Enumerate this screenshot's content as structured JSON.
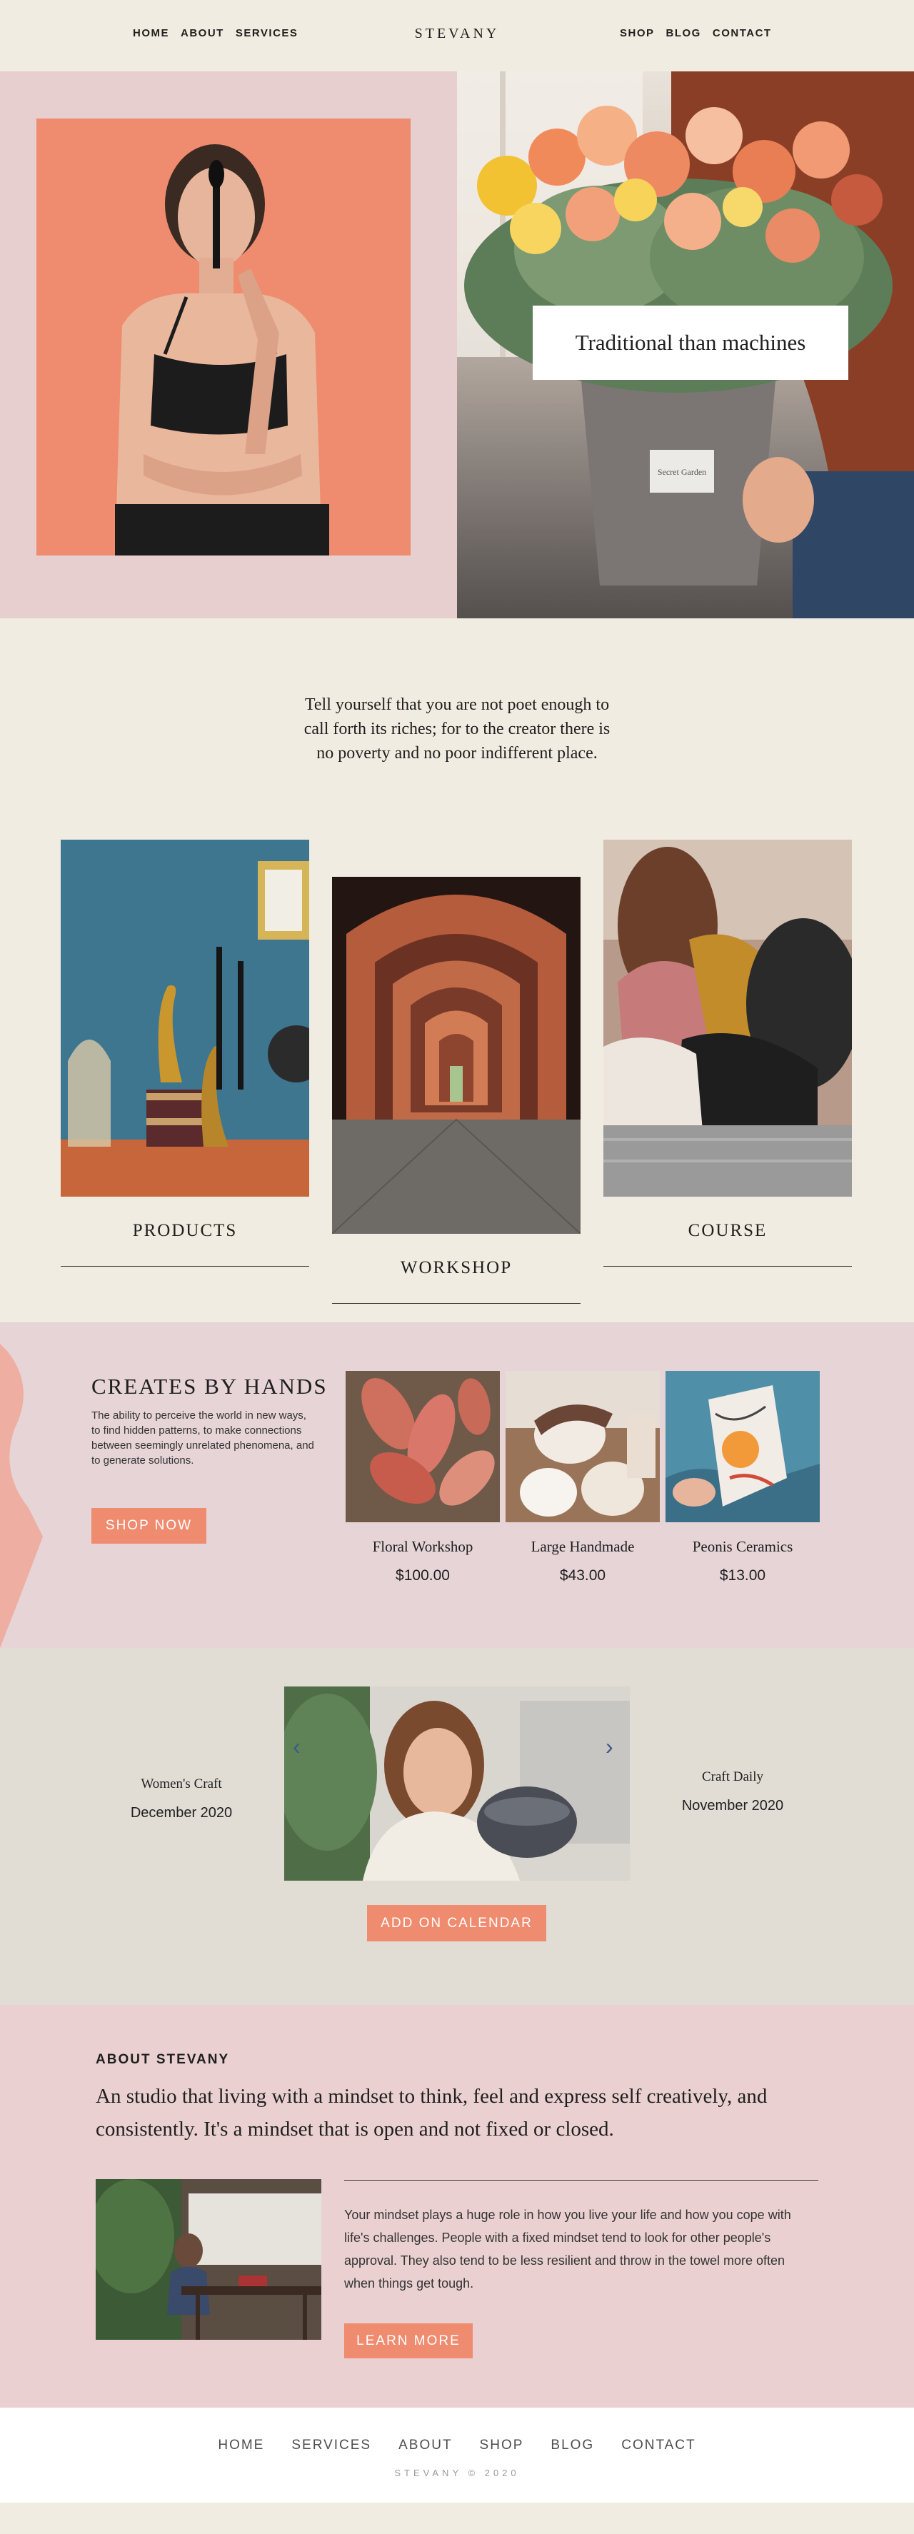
{
  "header": {
    "brand": "STEVANY",
    "nav_left": [
      "HOME",
      "ABOUT",
      "SERVICES"
    ],
    "nav_right": [
      "SHOP",
      "BLOG",
      "CONTACT"
    ]
  },
  "hero": {
    "quote": "Traditional than machines",
    "pot_label": "Secret Garden"
  },
  "intro": {
    "text": "Tell yourself that you are not poet enough to call forth its riches; for to the creator there is no poverty and no poor indifferent place."
  },
  "categories": [
    {
      "label": "PRODUCTS"
    },
    {
      "label": "WORKSHOP"
    },
    {
      "label": "COURSE"
    }
  ],
  "hands": {
    "title": "CREATES BY HANDS",
    "description": "The ability to perceive the world in new ways, to find hidden patterns, to make connections between seemingly unrelated phenomena, and to generate solutions.",
    "button": "SHOP NOW",
    "products": [
      {
        "name": "Floral Workshop",
        "price": "$100.00"
      },
      {
        "name": "Large Handmade",
        "price": "$43.00"
      },
      {
        "name": "Peonis Ceramics",
        "price": "$13.00"
      }
    ]
  },
  "event": {
    "left": {
      "title": "Women's Craft",
      "date": "December 2020"
    },
    "right": {
      "title": "Craft Daily",
      "date": "November 2020"
    },
    "button": "ADD ON CALENDAR"
  },
  "about": {
    "kicker": "ABOUT STEVANY",
    "lead": "An studio that living with a mindset to think, feel and express self creatively, and consistently. It's a mindset that is open and not fixed or closed.",
    "body": "Your mindset plays a huge role in how you live your life and how you cope with life's challenges. People with a fixed mindset tend to look for other people's approval. They also tend to be less resilient and throw in the towel more often when things get tough.",
    "button": "LEARN MORE"
  },
  "footer": {
    "links": [
      "HOME",
      "SERVICES",
      "ABOUT",
      "SHOP",
      "BLOG",
      "CONTACT"
    ],
    "copyright": "STEVANY © 2020"
  },
  "colors": {
    "accent": "#ef8b6f",
    "cream": "#f1ece1",
    "pink": "#ead0d0",
    "stone": "#e1ddd5"
  }
}
